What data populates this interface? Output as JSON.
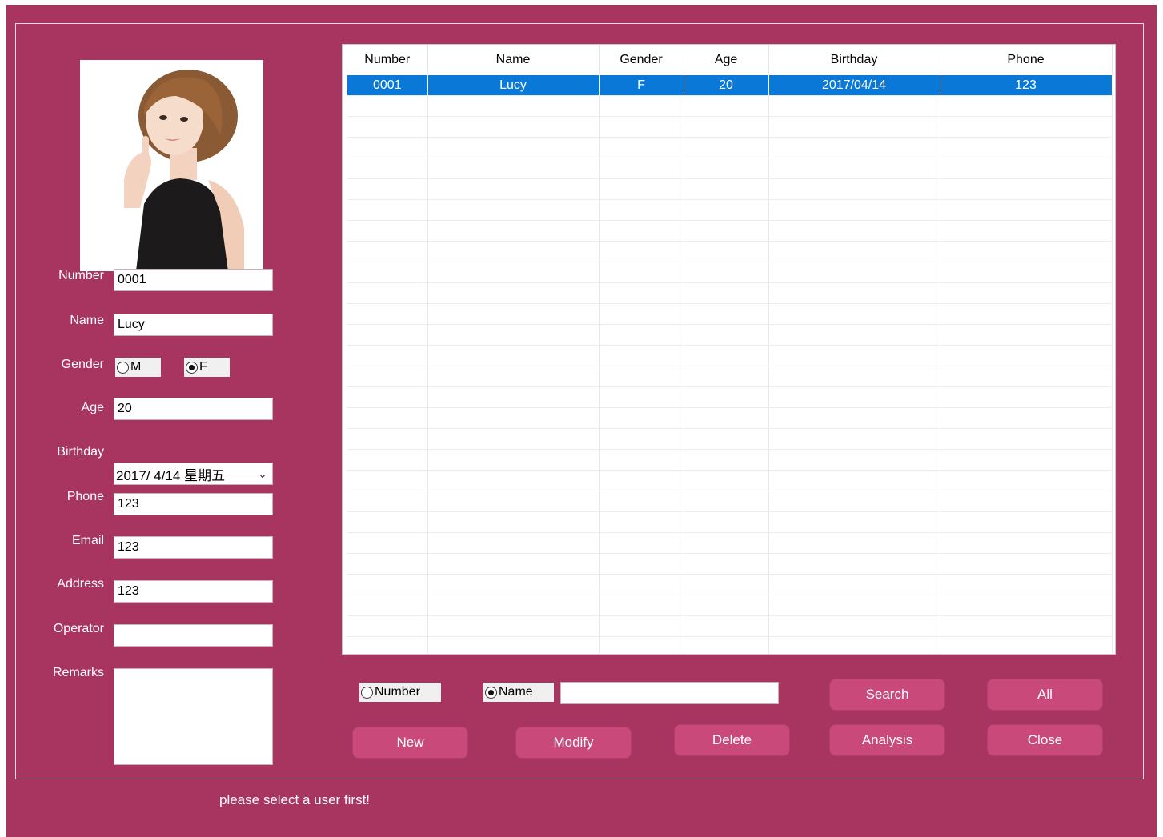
{
  "form": {
    "number_label": "Number",
    "number_value": "0001",
    "name_label": "Name",
    "name_value": "Lucy",
    "gender_label": "Gender",
    "gender_m": "M",
    "gender_f": "F",
    "gender_selected": "F",
    "age_label": "Age",
    "age_value": "20",
    "birthday_label": "Birthday",
    "birthday_value": "2017/  4/14 星期五",
    "phone_label": "Phone",
    "phone_value": "123",
    "email_label": "Email",
    "email_value": "123",
    "address_label": "Address",
    "address_value": "123",
    "operator_label": "Operator",
    "operator_value": "",
    "remarks_label": "Remarks",
    "remarks_value": ""
  },
  "table": {
    "columns": [
      "Number",
      "Name",
      "Gender",
      "Age",
      "Birthday",
      "Phone"
    ],
    "rows": [
      [
        "0001",
        "Lucy",
        "F",
        "20",
        "2017/04/14",
        "123"
      ]
    ],
    "selected_row": 0
  },
  "search": {
    "by_number": "Number",
    "by_name": "Name",
    "selected": "Name",
    "query": ""
  },
  "buttons": {
    "search": "Search",
    "all": "All",
    "new": "New",
    "modify": "Modify",
    "delete": "Delete",
    "analysis": "Analysis",
    "close": "Close"
  },
  "status": "please select a user first!",
  "colors": {
    "window_bg": "#a8355f",
    "button_bg": "#c94a7a",
    "selection": "#0a78d7"
  }
}
